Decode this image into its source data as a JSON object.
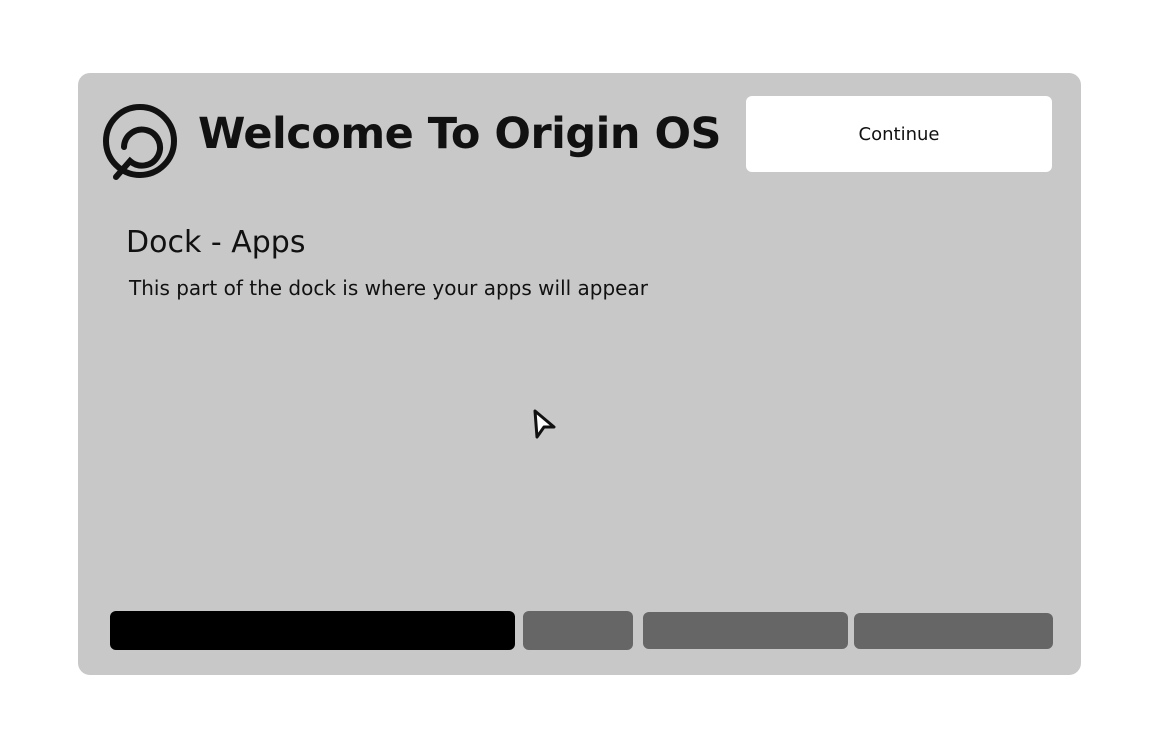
{
  "header": {
    "logo_icon": "origin-logo-icon",
    "title": "Welcome To Origin OS",
    "continue_label": "Continue"
  },
  "section": {
    "title": "Dock - Apps",
    "description": "This part of the dock is where your apps will appear"
  },
  "progress": {
    "steps": 4,
    "current_step": 1,
    "active_color": "#000000",
    "inactive_color": "#666666"
  },
  "colors": {
    "panel_background": "#c8c8c8",
    "page_background": "#ffffff",
    "button_background": "#ffffff"
  }
}
